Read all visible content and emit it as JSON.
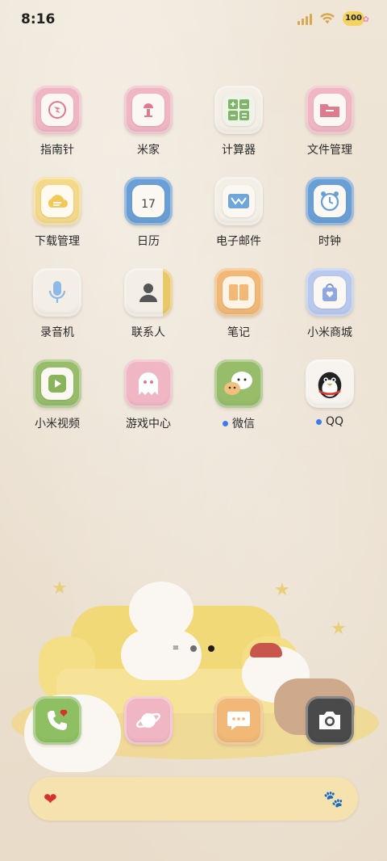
{
  "status_bar": {
    "time": "8:16",
    "battery": "100",
    "icons": [
      "signal-icon",
      "wifi-icon",
      "battery-icon"
    ]
  },
  "apps": [
    {
      "label": "指南针",
      "icon": "compass-icon",
      "color": "#f0b6c4"
    },
    {
      "label": "米家",
      "icon": "mijia-icon",
      "color": "#f0b6c4"
    },
    {
      "label": "计算器",
      "icon": "calculator-icon",
      "color": "#f3efe6"
    },
    {
      "label": "文件管理",
      "icon": "folder-icon",
      "color": "#f0b6c4"
    },
    {
      "label": "下载管理",
      "icon": "download-cloud-icon",
      "color": "#f4d98a"
    },
    {
      "label": "日历",
      "icon": "calendar-icon",
      "color": "#6a9fd6",
      "value": "17"
    },
    {
      "label": "电子邮件",
      "icon": "email-icon",
      "color": "#f3efe6"
    },
    {
      "label": "时钟",
      "icon": "clock-icon",
      "color": "#6a9fd6"
    },
    {
      "label": "录音机",
      "icon": "microphone-icon",
      "color": "#f3efe6"
    },
    {
      "label": "联系人",
      "icon": "contacts-icon",
      "color": "#f3efe6"
    },
    {
      "label": "笔记",
      "icon": "notes-icon",
      "color": "#f1b877"
    },
    {
      "label": "小米商城",
      "icon": "shop-bag-icon",
      "color": "#b9c9ee"
    },
    {
      "label": "小米视频",
      "icon": "video-play-icon",
      "color": "#97bd6b"
    },
    {
      "label": "游戏中心",
      "icon": "game-ghost-icon",
      "color": "#f0b6c4"
    },
    {
      "label": "微信",
      "icon": "wechat-icon",
      "color": "#97bd6b",
      "notification": true
    },
    {
      "label": "QQ",
      "icon": "qq-penguin-icon",
      "color": "#f7f4ef",
      "notification": true
    }
  ],
  "page_indicator": {
    "pages": 2,
    "active": 2
  },
  "dock": [
    {
      "icon": "phone-icon",
      "color": "#8fbf63"
    },
    {
      "icon": "browser-planet-icon",
      "color": "#f0b6c4"
    },
    {
      "icon": "message-bubble-icon",
      "color": "#f1b877"
    },
    {
      "icon": "camera-icon",
      "color": "#4a4a4a"
    }
  ],
  "search_bar": {
    "left_icon": "heart-icon",
    "right_icon": "paw-icon"
  }
}
